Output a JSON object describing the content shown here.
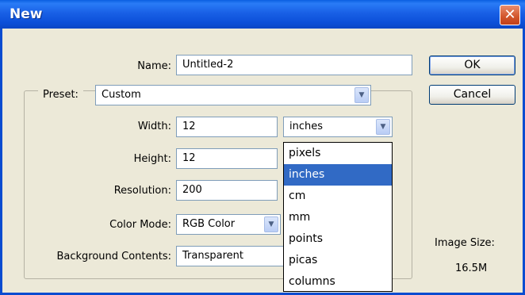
{
  "window": {
    "title": "New",
    "close_label": "✕"
  },
  "form": {
    "name_label": "Name:",
    "name_value": "Untitled-2",
    "preset_label": "Preset:",
    "preset_value": "Custom",
    "width_label": "Width:",
    "width_value": "12",
    "width_unit": "inches",
    "height_label": "Height:",
    "height_value": "12",
    "resolution_label": "Resolution:",
    "resolution_value": "200",
    "color_mode_label": "Color Mode:",
    "color_mode_value": "RGB Color",
    "background_label": "Background Contents:",
    "background_value": "Transparent"
  },
  "units_dropdown": {
    "options": [
      "pixels",
      "inches",
      "cm",
      "mm",
      "points",
      "picas",
      "columns"
    ],
    "selected": "inches"
  },
  "buttons": {
    "ok": "OK",
    "cancel": "Cancel"
  },
  "info": {
    "image_size_label": "Image Size:",
    "image_size_value": "16.5M"
  },
  "icons": {
    "close": "close-icon",
    "dropdown": "chevron-down-icon"
  },
  "colors": {
    "titlebar": "#0b52dc",
    "selection": "#316ac5",
    "dialog_bg": "#ece9d8"
  }
}
